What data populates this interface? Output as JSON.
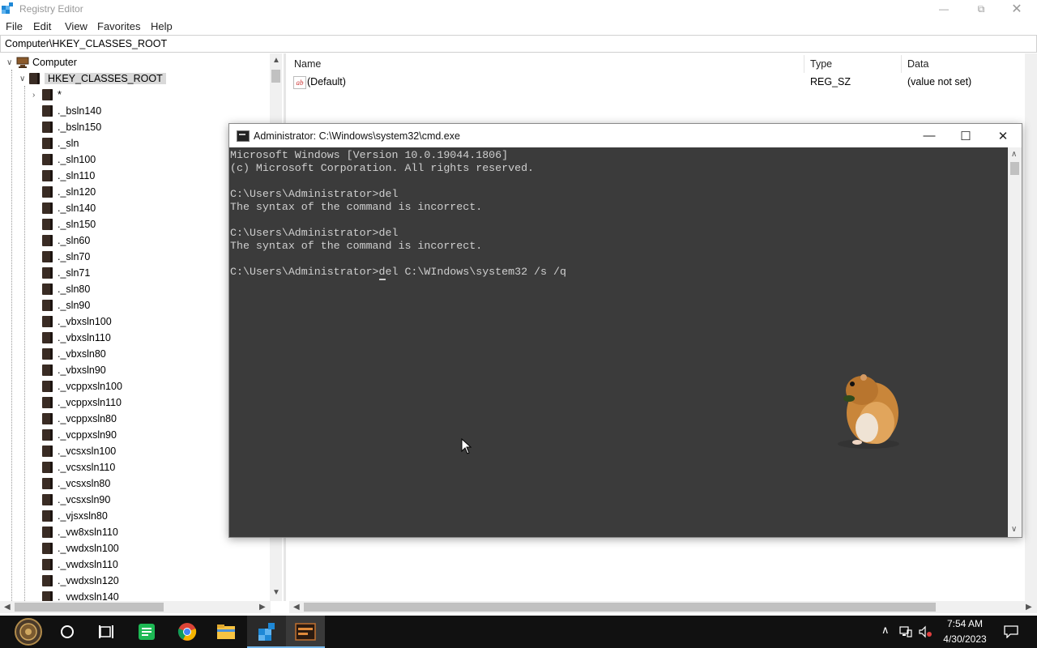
{
  "regedit": {
    "title": "Registry Editor",
    "menu": [
      "File",
      "Edit",
      "View",
      "Favorites",
      "Help"
    ],
    "address": "Computer\\HKEY_CLASSES_ROOT",
    "tree": {
      "root": "Computer",
      "hive": "HKEY_CLASSES_ROOT",
      "keys": [
        "*",
        "._bsln140",
        "._bsln150",
        "._sln",
        "._sln100",
        "._sln110",
        "._sln120",
        "._sln140",
        "._sln150",
        "._sln60",
        "._sln70",
        "._sln71",
        "._sln80",
        "._sln90",
        "._vbxsln100",
        "._vbxsln110",
        "._vbxsln80",
        "._vbxsln90",
        "._vcppxsln100",
        "._vcppxsln110",
        "._vcppxsln80",
        "._vcppxsln90",
        "._vcsxsln100",
        "._vcsxsln110",
        "._vcsxsln80",
        "._vcsxsln90",
        "._vjsxsln80",
        "._vw8xsln110",
        "._vwdxsln100",
        "._vwdxsln110",
        "._vwdxsln120",
        "._vwdxsln140"
      ]
    },
    "list": {
      "columns": [
        "Name",
        "Type",
        "Data"
      ],
      "rows": [
        {
          "name": "(Default)",
          "type": "REG_SZ",
          "data": "(value not set)",
          "icon": "ab-string-icon"
        }
      ]
    }
  },
  "cmd": {
    "title": "Administrator: C:\\Windows\\system32\\cmd.exe",
    "lines": [
      "Microsoft Windows [Version 10.0.19044.1806]",
      "(c) Microsoft Corporation. All rights reserved.",
      "",
      "C:\\Users\\Administrator>del",
      "The syntax of the command is incorrect.",
      "",
      "C:\\Users\\Administrator>del",
      "The syntax of the command is incorrect.",
      "",
      "C:\\Users\\Administrator>del C:\\WIndows\\system32 /s /q"
    ]
  },
  "taskbar": {
    "time": "7:54 AM",
    "date": "4/30/2023",
    "apps": [
      "start-icon",
      "search-circle-icon",
      "task-view-icon",
      "spreadsheet-app-icon",
      "chrome-icon",
      "file-explorer-icon",
      "registry-editor-icon",
      "cmd-icon"
    ]
  }
}
